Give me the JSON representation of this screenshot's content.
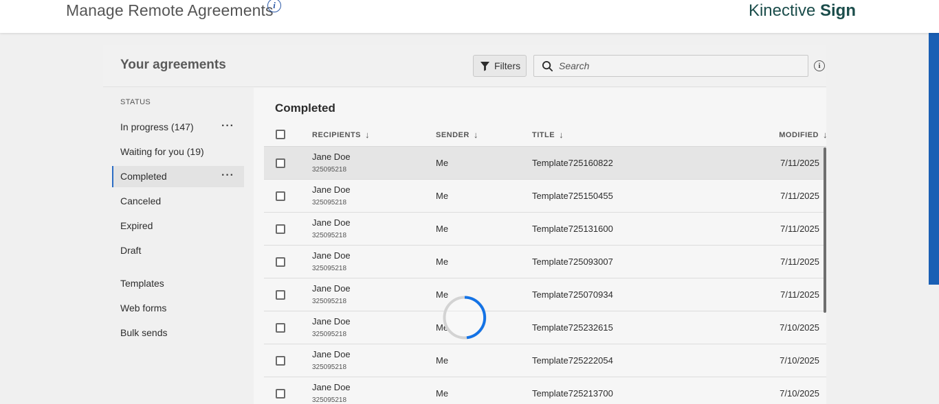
{
  "header": {
    "page_title": "Manage Remote Agreements",
    "brand_light": "Kinective",
    "brand_strong": "Sign"
  },
  "panel": {
    "heading": "Your agreements",
    "filters_label": "Filters",
    "search_placeholder": "Search"
  },
  "sidebar": {
    "status_heading": "STATUS",
    "items": [
      {
        "label": "In progress (147)",
        "more": "···"
      },
      {
        "label": "Waiting for you (19)"
      },
      {
        "label": "Completed",
        "more": "···"
      },
      {
        "label": "Canceled"
      },
      {
        "label": "Expired"
      },
      {
        "label": "Draft"
      },
      {
        "label": "Templates"
      },
      {
        "label": "Web forms"
      },
      {
        "label": "Bulk sends"
      }
    ],
    "active": "Completed"
  },
  "table": {
    "section_title": "Completed",
    "columns": {
      "recipients": "RECIPIENTS",
      "sender": "SENDER",
      "title": "TITLE",
      "modified": "MODIFIED"
    },
    "rows": [
      {
        "name": "Jane Doe",
        "id": "325095218",
        "sender": "Me",
        "title": "Template725160822",
        "modified": "7/11/2025"
      },
      {
        "name": "Jane Doe",
        "id": "325095218",
        "sender": "Me",
        "title": "Template725150455",
        "modified": "7/11/2025"
      },
      {
        "name": "Jane Doe",
        "id": "325095218",
        "sender": "Me",
        "title": "Template725131600",
        "modified": "7/11/2025"
      },
      {
        "name": "Jane Doe",
        "id": "325095218",
        "sender": "Me",
        "title": "Template725093007",
        "modified": "7/11/2025"
      },
      {
        "name": "Jane Doe",
        "id": "325095218",
        "sender": "Me",
        "title": "Template725070934",
        "modified": "7/11/2025"
      },
      {
        "name": "Jane Doe",
        "id": "325095218",
        "sender": "Me",
        "title": "Template725232615",
        "modified": "7/10/2025"
      },
      {
        "name": "Jane Doe",
        "id": "325095218",
        "sender": "Me",
        "title": "Template725222054",
        "modified": "7/10/2025"
      },
      {
        "name": "Jane Doe",
        "id": "325095218",
        "sender": "Me",
        "title": "Template725213700",
        "modified": "7/10/2025"
      }
    ]
  },
  "colors": {
    "accent": "#2b6cc4",
    "brand": "#1b4d4b",
    "scroll_accent": "#1a5fb4"
  },
  "icons": {
    "info": "info-icon",
    "filter": "filter-icon",
    "search": "search-icon",
    "sort": "sort-down-arrow-icon",
    "loading": "loading-spinner-icon"
  }
}
